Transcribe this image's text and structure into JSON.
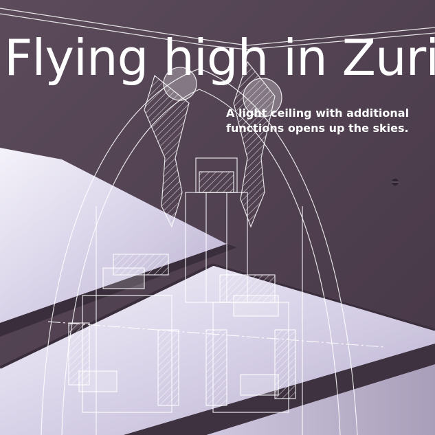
{
  "headline": "Flying high in Zurich",
  "subheadline": {
    "line1": "A light ceiling with additional",
    "line2": "functions opens up the skies."
  },
  "colors": {
    "ceiling_dark": "#4a3a4a",
    "light_panel": "#e4e0f0",
    "drawing_lines": "#ffffff",
    "text": "#ffffff"
  }
}
